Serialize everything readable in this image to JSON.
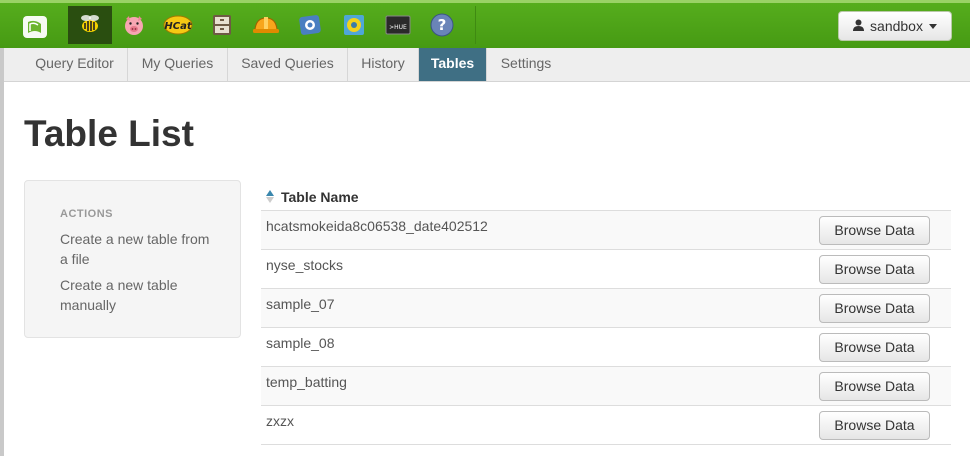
{
  "navbar": {
    "apps": [
      {
        "name": "hue-logo-icon"
      },
      {
        "name": "beeswax-icon",
        "active": true
      },
      {
        "name": "pig-icon"
      },
      {
        "name": "hcat-icon"
      },
      {
        "name": "file-browser-icon"
      },
      {
        "name": "job-designer-icon"
      },
      {
        "name": "oozie-icon"
      },
      {
        "name": "job-browser-icon"
      },
      {
        "name": "hue-shell-icon"
      },
      {
        "name": "help-icon"
      }
    ],
    "user_label": "sandbox"
  },
  "subnav": {
    "tabs": [
      {
        "label": "Query Editor"
      },
      {
        "label": "My Queries"
      },
      {
        "label": "Saved Queries"
      },
      {
        "label": "History"
      },
      {
        "label": "Tables",
        "active": true
      },
      {
        "label": "Settings"
      }
    ]
  },
  "page": {
    "title": "Table List"
  },
  "sidebar": {
    "header": "ACTIONS",
    "links": [
      {
        "label": "Create a new table from a file"
      },
      {
        "label": "Create a new table manually"
      }
    ]
  },
  "table": {
    "column_header": "Table Name",
    "browse_label": "Browse Data",
    "rows": [
      {
        "name": "hcatsmokeida8c06538_date402512"
      },
      {
        "name": "nyse_stocks"
      },
      {
        "name": "sample_07"
      },
      {
        "name": "sample_08"
      },
      {
        "name": "temp_batting"
      },
      {
        "name": "zxzx"
      }
    ]
  },
  "colors": {
    "navbar_green": "#56ad1d",
    "active_tab": "#3f6f84",
    "active_app": "#2a4e10"
  }
}
